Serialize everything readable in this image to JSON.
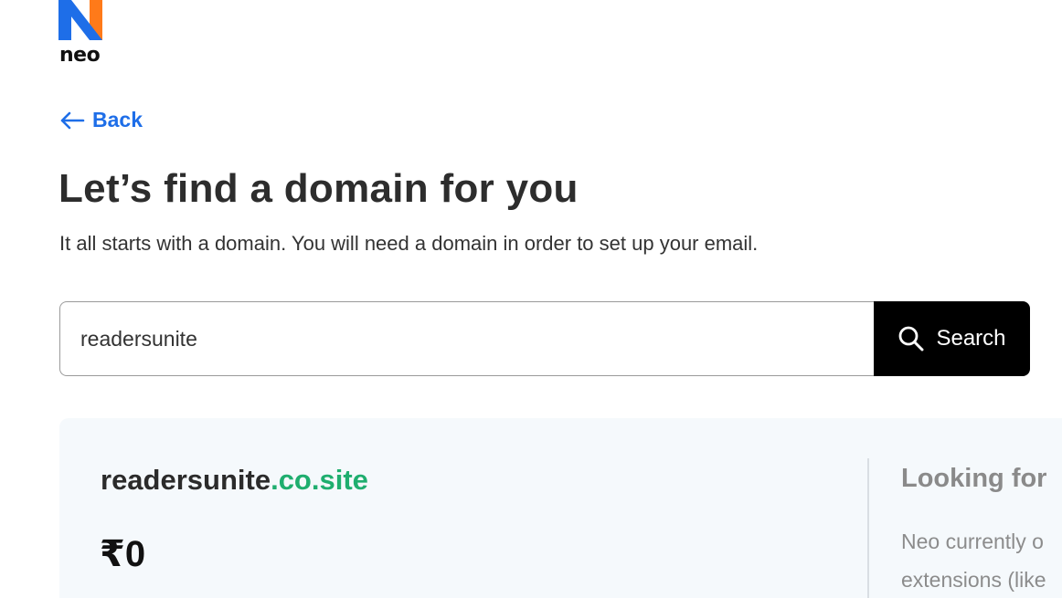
{
  "brand": {
    "name": "neo",
    "colors": {
      "blue": "#1e6ee8",
      "orange": "#ff7a1a",
      "green": "#1fae6f"
    }
  },
  "nav": {
    "back_label": "Back"
  },
  "header": {
    "title": "Let’s find a domain for you",
    "subtitle": "It all starts with a domain. You will need a domain in order to set up your email."
  },
  "search": {
    "value": "readersunite",
    "button_label": "Search"
  },
  "result": {
    "domain_name": "readersunite",
    "domain_ext": ".co.site",
    "price": "₹0",
    "side_title": "Looking for",
    "side_text_line1": "Neo currently o",
    "side_text_line2": "extensions (like"
  }
}
